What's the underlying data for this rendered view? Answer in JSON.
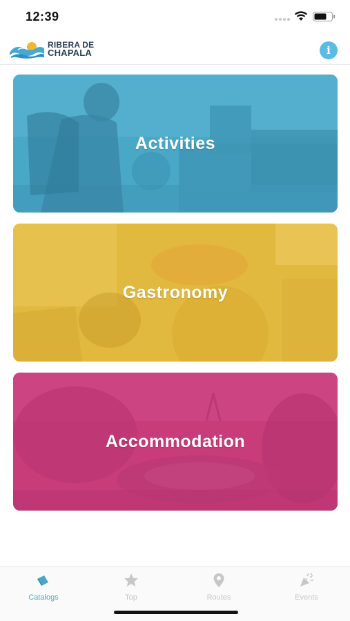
{
  "status_bar": {
    "time": "12:39"
  },
  "header": {
    "logo_line1": "RIBERA DE",
    "logo_line2": "CHAPALA",
    "info_icon": "info-icon"
  },
  "cards": [
    {
      "label": "Activities",
      "color": "#4aa8c7"
    },
    {
      "label": "Gastronomy",
      "color": "#e2b93f"
    },
    {
      "label": "Accommodation",
      "color": "#c83c7a"
    }
  ],
  "tab_bar": {
    "active_color": "#4aa8c7",
    "inactive_color": "#c7c7c7",
    "tabs": [
      {
        "label": "Catalogs",
        "icon": "catalog-icon",
        "active": true
      },
      {
        "label": "Top",
        "icon": "star-icon",
        "active": false
      },
      {
        "label": "Routes",
        "icon": "map-pin-icon",
        "active": false
      },
      {
        "label": "Events",
        "icon": "party-popper-icon",
        "active": false
      }
    ]
  }
}
